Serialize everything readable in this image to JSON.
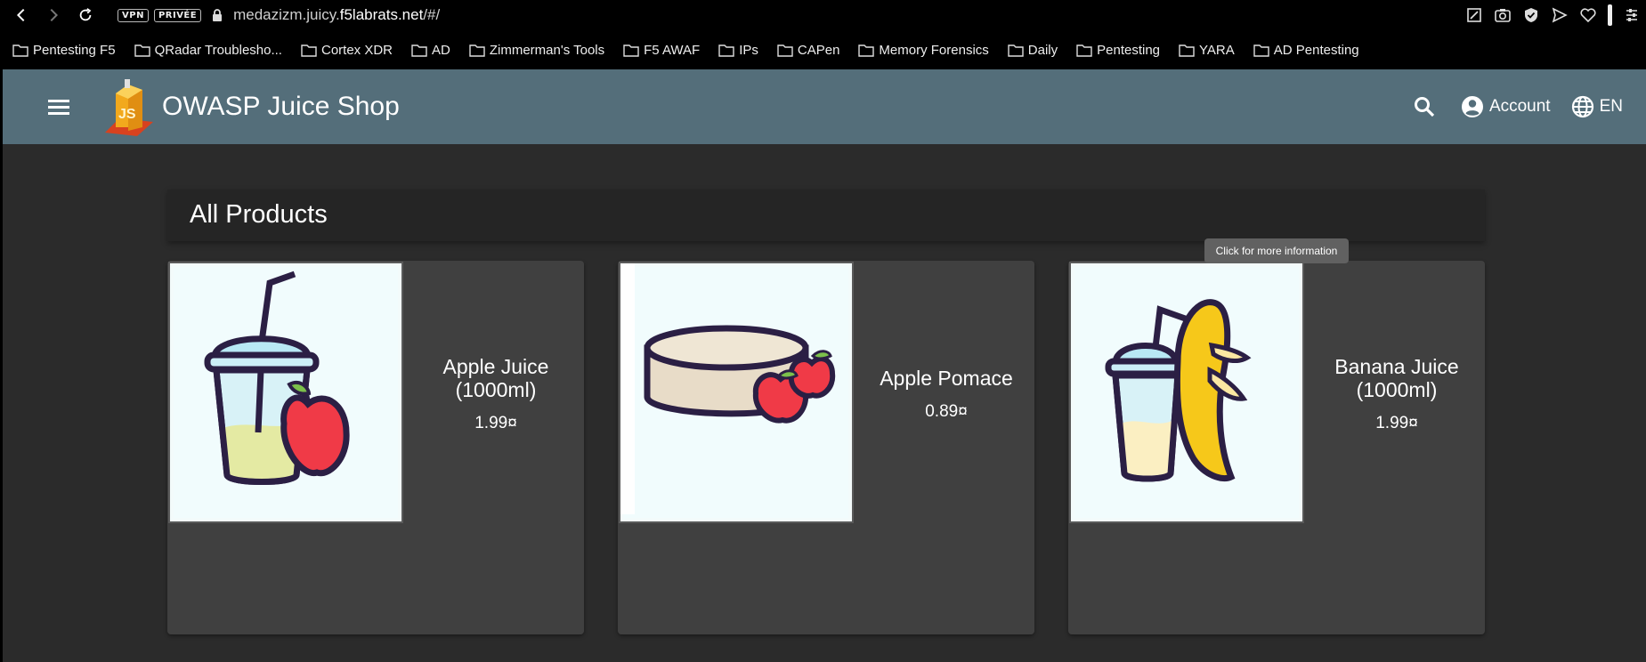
{
  "browser": {
    "vpn_label": "VPN",
    "private_label": "PRIVÉE",
    "url_prefix": "medazizm.juicy.",
    "url_domain": "f5labrats.net",
    "url_suffix": "/#/",
    "bookmarks": [
      {
        "label": "Pentesting F5"
      },
      {
        "label": "QRadar Troublesho..."
      },
      {
        "label": "Cortex XDR"
      },
      {
        "label": "AD"
      },
      {
        "label": "Zimmerman's Tools"
      },
      {
        "label": "F5 AWAF"
      },
      {
        "label": "IPs"
      },
      {
        "label": "CAPen"
      },
      {
        "label": "Memory Forensics"
      },
      {
        "label": "Daily"
      },
      {
        "label": "Pentesting"
      },
      {
        "label": "YARA"
      },
      {
        "label": "AD Pentesting"
      }
    ]
  },
  "app": {
    "title": "OWASP Juice Shop",
    "account_label": "Account",
    "language_label": "EN",
    "toolbar_color": "#546e7a"
  },
  "main": {
    "heading": "All Products",
    "tooltip": "Click for more information",
    "products": [
      {
        "name_line1": "Apple Juice",
        "name_line2": "(1000ml)",
        "price": "1.99¤",
        "image_icon": "apple-juice-icon"
      },
      {
        "name_line1": "Apple Pomace",
        "name_line2": "",
        "price": "0.89¤",
        "image_icon": "apple-pomace-icon"
      },
      {
        "name_line1": "Banana Juice",
        "name_line2": "(1000ml)",
        "price": "1.99¤",
        "image_icon": "banana-juice-icon"
      }
    ]
  }
}
